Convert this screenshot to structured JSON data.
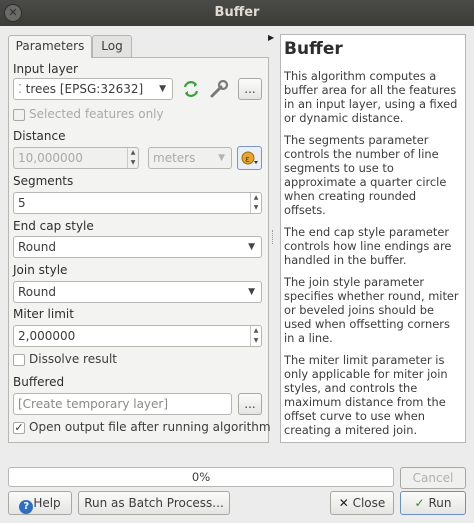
{
  "window": {
    "title": "Buffer"
  },
  "tabs": [
    {
      "label": "Parameters"
    },
    {
      "label": "Log"
    }
  ],
  "params": {
    "input_layer_label": "Input layer",
    "input_layer_value": "trees [EPSG:32632]",
    "selected_only_label": "Selected features only",
    "distance_label": "Distance",
    "distance_value": "10,000000",
    "distance_unit": "meters",
    "segments_label": "Segments",
    "segments_value": "5",
    "end_cap_label": "End cap style",
    "end_cap_value": "Round",
    "join_style_label": "Join style",
    "join_style_value": "Round",
    "miter_label": "Miter limit",
    "miter_value": "2,000000",
    "dissolve_label": "Dissolve result",
    "buffered_label": "Buffered",
    "buffered_placeholder": "[Create temporary layer]",
    "open_output_label": "Open output file after running algorithm",
    "browse_label": "..."
  },
  "help": {
    "title": "Buffer",
    "paragraphs": [
      "This algorithm computes a buffer area for all the features in an input layer, using a fixed or dynamic distance.",
      "The segments parameter controls the number of line segments to use to approximate a quarter circle when creating rounded offsets.",
      "The end cap style parameter controls how line endings are handled in the buffer.",
      "The join style parameter specifies whether round, miter or beveled joins should be used when offsetting corners in a line.",
      "The miter limit parameter is only applicable for miter join styles, and controls the maximum distance from the offset curve to use when creating a mitered join."
    ]
  },
  "footer": {
    "progress_text": "0%",
    "progress_fraction": 0,
    "cancel_label": "Cancel",
    "help_label": "Help",
    "batch_label": "Run as Batch Process...",
    "close_label": "Close",
    "run_label": "Run"
  },
  "colors": {
    "titlebar": "#3b3b38",
    "run_check": "#2e8b2e",
    "close_x": "#222222"
  }
}
